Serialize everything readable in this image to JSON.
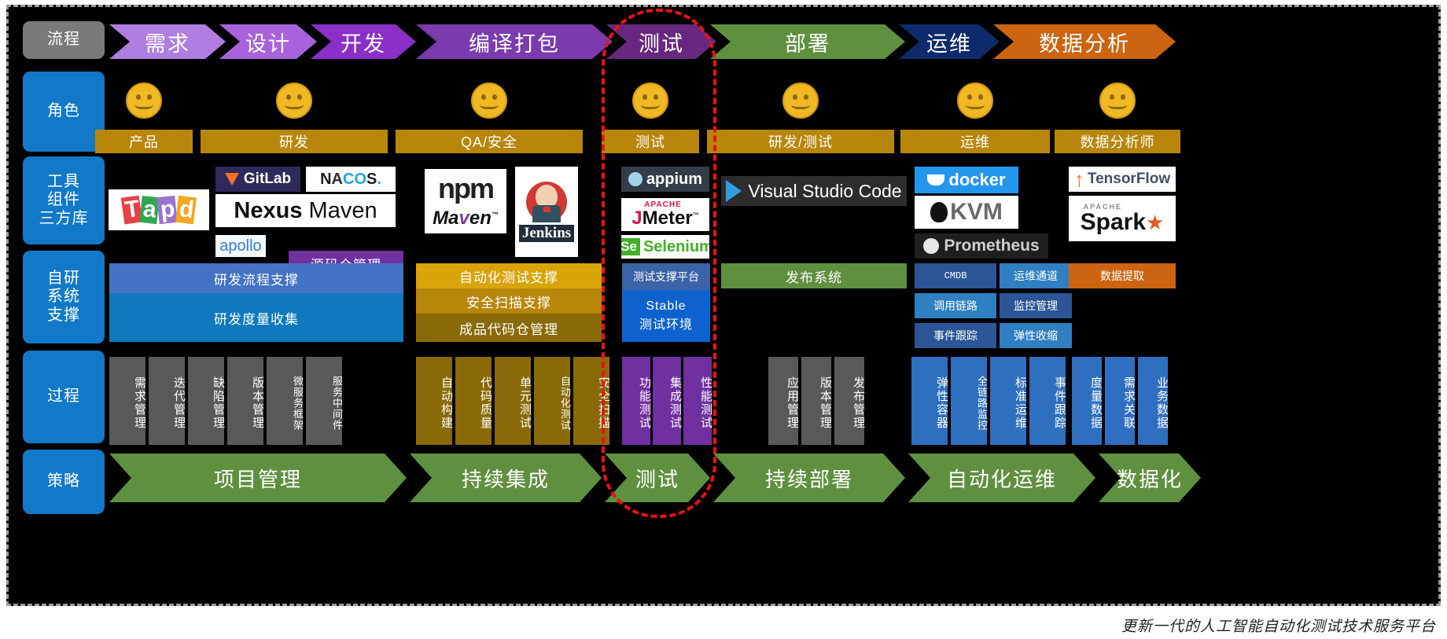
{
  "rows": {
    "process_label": "流程",
    "role_label": "角色",
    "tools_label": "工具\n组件\n三方库",
    "tools_label_lines": [
      "工具",
      "组件",
      "三方库"
    ],
    "selfdev_label_lines": [
      "自研",
      "系统",
      "支撑"
    ],
    "procedure_label": "过程",
    "strategy_label": "策略"
  },
  "pipeline": [
    {
      "label": "需求",
      "color": "#b07de0"
    },
    {
      "label": "设计",
      "color": "#a962dd"
    },
    {
      "label": "开发",
      "color": "#8b2fc9"
    },
    {
      "label": "编译打包",
      "color": "#7b3aad"
    },
    {
      "label": "测试",
      "color": "#68287f"
    },
    {
      "label": "部署",
      "color": "#5f9040"
    },
    {
      "label": "运维",
      "color": "#0d2b6b"
    },
    {
      "label": "数据分析",
      "color": "#cc6411"
    }
  ],
  "roles": [
    "产品",
    "研发",
    "QA/安全",
    "测试",
    "研发/测试",
    "运维",
    "数据分析师"
  ],
  "tools": {
    "tapd": "Tapd",
    "gitlab": "GitLab",
    "nacos": "NACOS.",
    "nexus": "Nexus",
    "maven": "Maven",
    "apollo": "apollo",
    "npm": "npm",
    "maven2": "Maven",
    "jenkins": "Jenkins",
    "appium": "appium",
    "jmeter_top": "APACHE",
    "jmeter": "JMeter",
    "jmeter_tm": "TM",
    "selenium_mark": "Se",
    "selenium": "Selenium",
    "vscode": "Visual Studio Code",
    "docker": "docker",
    "kvm": "KVM",
    "prometheus": "Prometheus",
    "tensorflow": "TensorFlow",
    "spark_top": "APACHE",
    "spark": "Spark"
  },
  "selfdev": {
    "src_repo": "源码仓管理",
    "dev_flow": "研发流程支撑",
    "dev_metric": "研发度量收集",
    "auto_test": "自动化测试支撑",
    "sec_scan": "安全扫描支撑",
    "artifact": "成品代码仓管理",
    "test_platform": "测试支撑平台",
    "stable_1": "Stable",
    "stable_2": "测试环境",
    "release_sys": "发布系统",
    "cmdb": "CMDB",
    "ops_channel": "运维通道",
    "trace_chain": "调用链路",
    "monitor": "监控管理",
    "event_track": "事件跟踪",
    "elastic": "弹性收缩",
    "data_extract": "数据提取"
  },
  "procedure": {
    "req": [
      "需求管理",
      "迭代管理",
      "缺陷管理",
      "版本管理",
      "微服务框架",
      "服务中间件"
    ],
    "ci": [
      "自动构建",
      "代码质量",
      "单元测试",
      "自动化测试",
      "安全扫描"
    ],
    "test": [
      "功能测试",
      "集成测试",
      "性能测试"
    ],
    "deploy": [
      "应用管理",
      "版本管理",
      "发布管理"
    ],
    "ops": [
      "弹性容器",
      "全链路监控",
      "标准运维",
      "事件跟踪"
    ],
    "data": [
      "度量数据",
      "需求关联",
      "业务数据"
    ]
  },
  "strategy": [
    {
      "label": "项目管理"
    },
    {
      "label": "持续集成"
    },
    {
      "label": "测试"
    },
    {
      "label": "持续部署"
    },
    {
      "label": "自动化运维"
    },
    {
      "label": "数据化"
    }
  ],
  "footer": "更新一代的人工智能自动化测试技术服务平台",
  "colors": {
    "bg": "#000000",
    "label_blue": "#1179c8",
    "label_grey": "#7a7a7a",
    "role_gold": "#b8860b",
    "selfdev_blue_light": "#4472c4",
    "selfdev_blue": "#0f79c0",
    "selfdev_purple": "#7030a0",
    "selfdev_gold": "#d9a40a",
    "selfdev_gold_dark": "#b8860b",
    "selfdev_olive": "#8a6a08",
    "green": "#5f9040",
    "orange": "#cc6411",
    "grey_chip": "#595959",
    "highlight_red": "#ee1111"
  }
}
